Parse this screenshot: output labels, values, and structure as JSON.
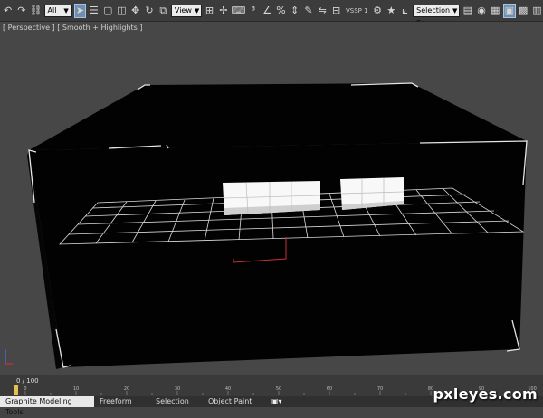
{
  "toolbar": {
    "filter_select": "All",
    "reference_select": "View",
    "snap_label": "VSSP 1",
    "selection_set_select": "Create Selection Se",
    "icons": [
      "undo-icon",
      "redo-icon",
      "link-icon",
      "unlink-icon",
      "bind-icon",
      "select-object-icon",
      "select-by-name-icon",
      "rect-select-icon",
      "window-crossing-icon",
      "move-icon",
      "rotate-icon",
      "scale-icon",
      "pivot-icon",
      "select-manipulate-icon",
      "keyboard-shortcut-icon",
      "snap-icon",
      "angle-snap-icon",
      "percent-snap-icon",
      "spinner-snap-icon",
      "named-selection-icon",
      "mirror-icon",
      "align-icon",
      "layer-icon",
      "ribbon-icon",
      "curve-editor-icon",
      "schematic-icon",
      "material-editor-icon",
      "render-setup-icon",
      "render-frame-icon",
      "render-icon"
    ]
  },
  "viewport": {
    "label": "[ Perspective ] [ Smooth + Highlights ]"
  },
  "timeline": {
    "frame_counter": "0 / 100",
    "current_frame": 0,
    "total_frames": 100,
    "tick_labels": [
      "0",
      "10",
      "20",
      "30",
      "40",
      "50",
      "60",
      "70",
      "80",
      "90",
      "100"
    ]
  },
  "ribbon_tabs": [
    {
      "label": "Graphite Modeling Tools",
      "active": true
    },
    {
      "label": "Freeform",
      "active": false
    },
    {
      "label": "Selection",
      "active": false
    },
    {
      "label": "Object Paint",
      "active": false
    }
  ],
  "watermark": "pxleyes.com"
}
